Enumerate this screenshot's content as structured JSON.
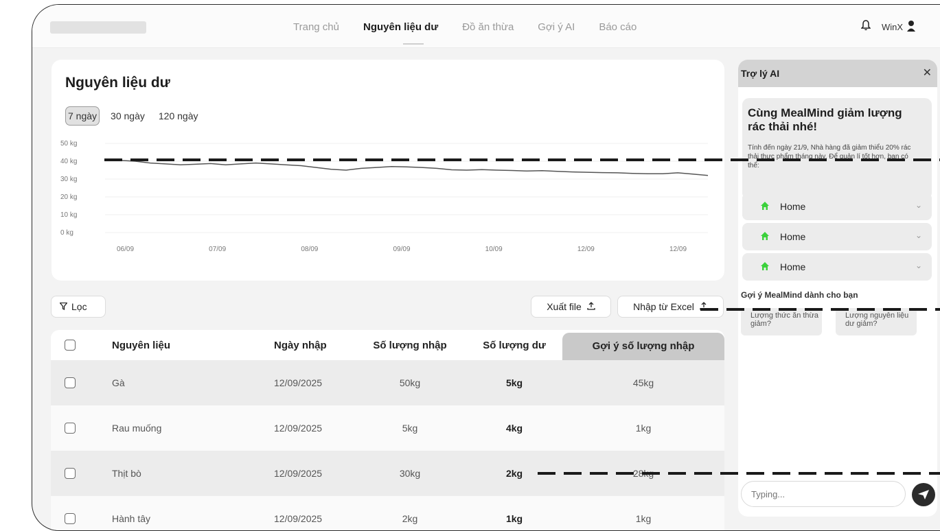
{
  "nav": {
    "items": [
      "Trang chủ",
      "Nguyên liệu dư",
      "Đồ ăn thừa",
      "Gợi ý AI",
      "Báo cáo"
    ],
    "active": "Nguyên liệu dư",
    "user": "WinX"
  },
  "chart_card": {
    "title": "Nguyên liệu dư",
    "ranges": [
      "7 ngày",
      "30 ngày",
      "120 ngày"
    ],
    "selected_range": "7 ngày"
  },
  "chart_data": {
    "type": "line",
    "title": "",
    "xlabel": "",
    "ylabel": "",
    "ylim": [
      0,
      50
    ],
    "yticks": [
      "50 kg",
      "40 kg",
      "30 kg",
      "20 kg",
      "10 kg",
      "0 kg"
    ],
    "xticks": [
      "06/09",
      "07/09",
      "08/09",
      "09/09",
      "10/09",
      "12/09",
      "12/09"
    ],
    "series": [
      {
        "values": [
          41,
          40.5,
          40,
          39,
          38.5,
          38,
          38.3,
          38.7,
          38,
          38.5,
          39,
          38.5,
          38,
          37.5,
          36.5,
          35.5,
          35,
          36,
          36.5,
          37,
          36.8,
          36.5,
          36,
          35.2,
          35,
          35.3,
          35,
          34.8,
          34.5,
          34.7,
          34.3,
          34,
          33.8,
          33.6,
          33.5,
          33.2,
          33,
          33,
          33.5,
          32.8,
          32
        ]
      }
    ],
    "grid": true,
    "color": "#555555"
  },
  "toolbar": {
    "filter_label": "Lọc",
    "export_label": "Xuất file",
    "import_label": "Nhập từ Excel"
  },
  "table": {
    "headers": [
      "Nguyên liệu",
      "Ngày nhập",
      "Số lượng nhập",
      "Số lượng dư",
      "Gợi ý số lượng nhập"
    ],
    "rows": [
      {
        "name": "Gà",
        "date": "12/09/2025",
        "qty_in": "50kg",
        "qty_left": "5kg",
        "suggest": "45kg"
      },
      {
        "name": "Rau muống",
        "date": "12/09/2025",
        "qty_in": "5kg",
        "qty_left": "4kg",
        "suggest": "1kg"
      },
      {
        "name": "Thịt bò",
        "date": "12/09/2025",
        "qty_in": "30kg",
        "qty_left": "2kg",
        "suggest": "28kg"
      },
      {
        "name": "Hành tây",
        "date": "12/09/2025",
        "qty_in": "2kg",
        "qty_left": "1kg",
        "suggest": "1kg"
      }
    ]
  },
  "ai_panel": {
    "title": "Trợ lý AI",
    "heading": "Cùng MealMind giảm lượng rác thải nhé!",
    "body": "Tính đến ngày 21/9, Nhà hàng đã giảm thiểu 20% rác thải thực phẩm tháng này. Để quản lí tốt hơn, bạn có thể:",
    "accordion": [
      "Home",
      "Home",
      "Home"
    ],
    "suggest_title": "Gợi ý MealMind dành cho bạn",
    "chips": [
      "Lượng thức ăn thừa giảm?",
      "Lượng nguyên liệu dư giảm?"
    ],
    "input_placeholder": "Typing..."
  },
  "colors": {
    "accent_icon": "#3bd13b",
    "header_highlight": "#c9c9c9",
    "send_button": "#2b2b2b"
  }
}
